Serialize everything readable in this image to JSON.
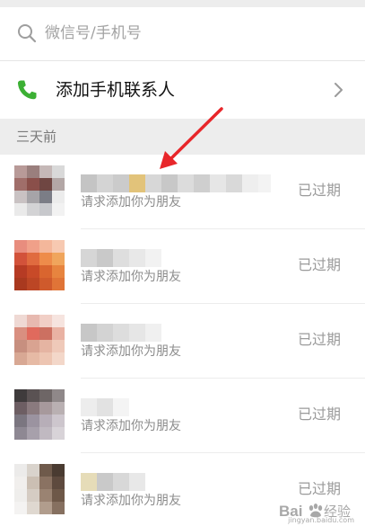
{
  "search": {
    "placeholder": "微信号/手机号",
    "icon": "search-icon"
  },
  "add_contact": {
    "label": "添加手机联系人",
    "icon": "phone-icon",
    "icon_color": "#3cb034"
  },
  "section": {
    "title": "三天前"
  },
  "requests": [
    {
      "subtitle": "请求添加你为朋友",
      "status": "已过期"
    },
    {
      "subtitle": "请求添加你为朋友",
      "status": "已过期"
    },
    {
      "subtitle": "请求添加你为朋友",
      "status": "已过期"
    },
    {
      "subtitle": "请求添加你为朋友",
      "status": "已过期"
    },
    {
      "subtitle": "请求添加你为朋友",
      "status": "已过期"
    }
  ],
  "annotation": {
    "arrow_color": "#e8262a"
  },
  "watermark": {
    "brand": "Bai 经验",
    "url": "jingyan.baidu.com"
  }
}
